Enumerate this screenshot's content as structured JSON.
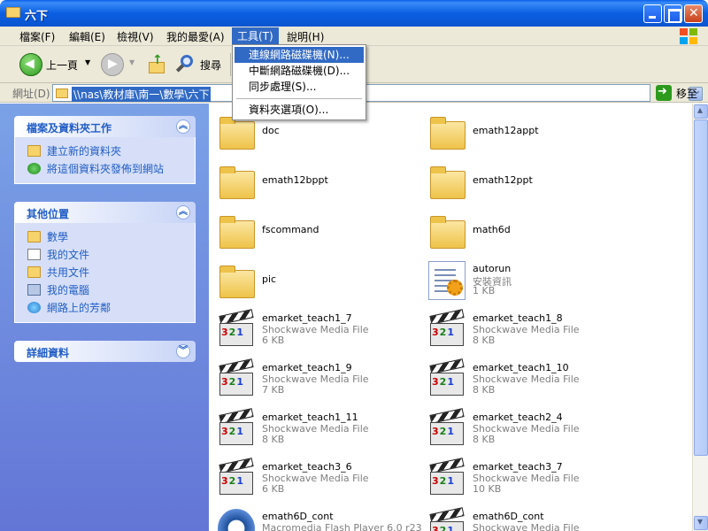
{
  "window": {
    "title": "六下"
  },
  "menubar": {
    "items": [
      {
        "label": "檔案(F)"
      },
      {
        "label": "編輯(E)"
      },
      {
        "label": "檢視(V)"
      },
      {
        "label": "我的最愛(A)"
      },
      {
        "label": "工具(T)"
      },
      {
        "label": "說明(H)"
      }
    ]
  },
  "tools_menu": {
    "items": [
      {
        "label": "連線網路磁碟機(N)..."
      },
      {
        "label": "中斷網路磁碟機(D)..."
      },
      {
        "label": "同步處理(S)..."
      },
      {
        "label": "資料夾選項(O)..."
      }
    ]
  },
  "toolbar": {
    "back_label": "上一頁",
    "search_label": "搜尋"
  },
  "address": {
    "label": "網址(D)",
    "value": "\\\\nas\\教材庫\\南一\\數學\\六下",
    "go_label": "移至"
  },
  "leftpanel": {
    "tasks": {
      "title": "檔案及資料夾工作",
      "items": [
        {
          "label": "建立新的資料夾"
        },
        {
          "label": "將這個資料夾發佈到網站"
        }
      ]
    },
    "places": {
      "title": "其他位置",
      "items": [
        {
          "label": "數學"
        },
        {
          "label": "我的文件"
        },
        {
          "label": "共用文件"
        },
        {
          "label": "我的電腦"
        },
        {
          "label": "網路上的芳鄰"
        }
      ]
    },
    "details": {
      "title": "詳細資料"
    }
  },
  "files": [
    {
      "name": "doc",
      "kind": "folder"
    },
    {
      "name": "emath12appt",
      "kind": "folder"
    },
    {
      "name": "emath12bppt",
      "kind": "folder"
    },
    {
      "name": "emath12ppt",
      "kind": "folder"
    },
    {
      "name": "fscommand",
      "kind": "folder"
    },
    {
      "name": "math6d",
      "kind": "folder"
    },
    {
      "name": "pic",
      "kind": "folder"
    },
    {
      "name": "autorun",
      "type": "安裝資訊",
      "size": "1 KB",
      "kind": "inf"
    },
    {
      "name": "emarket_teach1_7",
      "type": "Shockwave Media File",
      "size": "6 KB",
      "kind": "swf"
    },
    {
      "name": "emarket_teach1_8",
      "type": "Shockwave Media File",
      "size": "8 KB",
      "kind": "swf"
    },
    {
      "name": "emarket_teach1_9",
      "type": "Shockwave Media File",
      "size": "7 KB",
      "kind": "swf"
    },
    {
      "name": "emarket_teach1_10",
      "type": "Shockwave Media File",
      "size": "8 KB",
      "kind": "swf"
    },
    {
      "name": "emarket_teach1_11",
      "type": "Shockwave Media File",
      "size": "8 KB",
      "kind": "swf"
    },
    {
      "name": "emarket_teach2_4",
      "type": "Shockwave Media File",
      "size": "8 KB",
      "kind": "swf"
    },
    {
      "name": "emarket_teach3_6",
      "type": "Shockwave Media File",
      "size": "6 KB",
      "kind": "swf"
    },
    {
      "name": "emarket_teach3_7",
      "type": "Shockwave Media File",
      "size": "10 KB",
      "kind": "swf"
    },
    {
      "name": "emath6D_cont",
      "type": "Macromedia Flash Player 6.0 r23",
      "kind": "flash"
    },
    {
      "name": "emath6D_cont",
      "type": "Shockwave Media File",
      "kind": "swf"
    }
  ],
  "colors": {
    "title_bar": "#0a5fe8",
    "panel_bg": "#6f8fe0",
    "panel_text": "#215dc6",
    "selection": "#316ac5"
  }
}
